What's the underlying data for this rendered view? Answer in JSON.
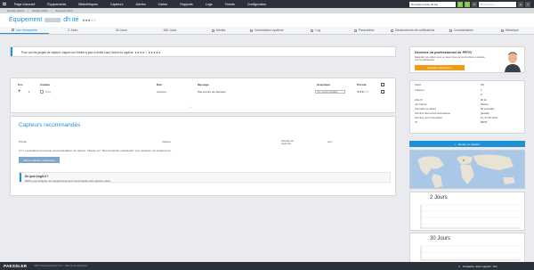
{
  "nav": {
    "items": [
      "Page d'accueil",
      "Équipements",
      "Bibliothèques",
      "Capteurs",
      "Alertes",
      "Cartes",
      "Rapports",
      "Logs",
      "Tickets",
      "Configuration"
    ],
    "refresh": "Nouvelle entrée de log",
    "search_placeholder": "Recherche..."
  },
  "breadcrumb": [
    "Groupe racine",
    "Sonde locale",
    "Serveurs Gold"
  ],
  "device": {
    "title": "Équipement",
    "title_suffix": "dh ité",
    "stars": "★★★☆☆"
  },
  "tabs": [
    "Vue d'ensemble",
    "2 Jours",
    "30 Jours",
    "365 Jours",
    "Alertes",
    "Informations système",
    "Log",
    "Paramètres",
    "Déclencheurs de notifications",
    "Commentaires",
    "Historique"
  ],
  "notice": "Pour voir les jauges de capteur, cliquez sur l'étoile la plus à droite sous l'icône du capteur. ★★★★☆ ★★★★★",
  "sensor_table": {
    "headers": [
      "Pos",
      "Capteur",
      "État",
      "Message",
      "Graphique",
      "Priorité"
    ],
    "rows": [
      {
        "pos": "1",
        "name": "Ping",
        "status": "Inconnu",
        "message": "Pas encore de données",
        "graph": "Voir courbe détaillée",
        "priority": "★★★☆☆"
      }
    ]
  },
  "recommended": {
    "title": "Capteurs recommandés",
    "cols": [
      "Priorité",
      "Capteur",
      "Nombre de capteurs",
      "Lien"
    ],
    "empty_text": "Il n'y a actuellement aucune recommandation de capteur. Cliquez sur \"Recommander maintenant\" pour analyser cet équipement.",
    "button": "Recommander maintenant",
    "help_title": "De quoi s'agit-il ?",
    "help_text": "PRTG peut analyser vos équipements pour recommander des capteurs utiles."
  },
  "promo": {
    "title": "Devenez un professionnel de PRTG",
    "sub": "Regardez nos vidéos pour en savoir plus sur les fonctions et étendre vos connaissances.",
    "button": "Regarder maintenant ▸"
  },
  "props": [
    {
      "label": "Statut",
      "value": "OK"
    },
    {
      "label": "Capteurs",
      "value": "1"
    },
    {
      "label": "",
      "value": "0"
    },
    {
      "label": "Hôte IP",
      "value": "dh ité"
    },
    {
      "label": "Abondance",
      "value": "Partout"
    },
    {
      "label": "Intervalle par défaut",
      "value": "60 secondes"
    },
    {
      "label": "Dernière découverte automatique",
      "value": "(jamais)"
    },
    {
      "label": "Dernière recommandation",
      "value": "8 j, 3 h 30 Jours"
    },
    {
      "label": "ID",
      "value": "#0071"
    }
  ],
  "add_sensor": "Ajouter un capteur",
  "graphs": [
    "2 Jours",
    "30 Jours"
  ],
  "footer": {
    "logo": "PAESSLER",
    "version": "PRTG Network Monitor 23.1 · Mise à jour disponible",
    "contact": "Contacter notre support · Pro"
  },
  "colors": {
    "accent": "#1f8fd6",
    "nav_bg": "#2b3138",
    "promo_btn": "#f39c12",
    "ok_green": "#8bc34a"
  }
}
